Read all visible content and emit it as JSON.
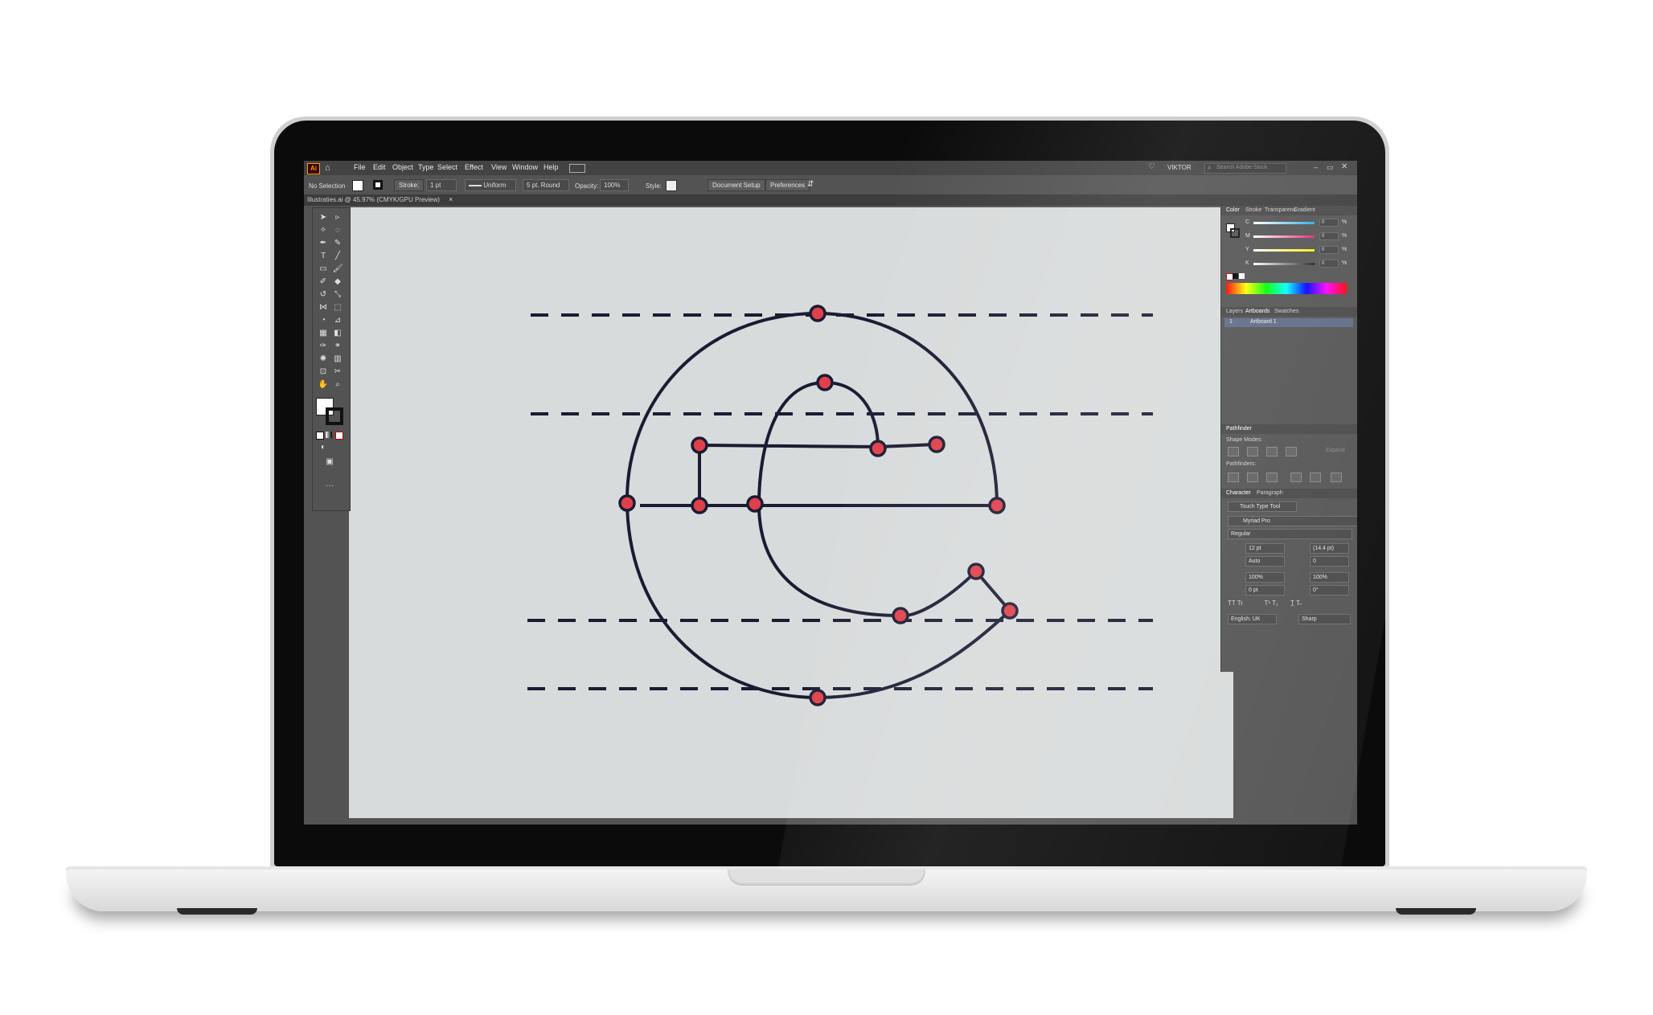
{
  "app": {
    "logo": "Ai",
    "title_tab": "Illustraties.ai @ 45.97% (CMYK/GPU Preview)",
    "close_tab": "×"
  },
  "menu": [
    "File",
    "Edit",
    "Object",
    "Type",
    "Select",
    "Effect",
    "View",
    "Window",
    "Help"
  ],
  "topright": {
    "user": "VIKTOR",
    "search_placeholder": "Search Adobe Stock"
  },
  "control": {
    "selection": "No Selection",
    "stroke_label": "Stroke:",
    "stroke_weight": "1 pt",
    "profile": "Uniform",
    "brush": "5 pt. Round",
    "opacity_label": "Opacity:",
    "opacity": "100%",
    "style_label": "Style:",
    "document_setup": "Document Setup",
    "preferences": "Preferences"
  },
  "panels": {
    "color_tabs": [
      "Color",
      "Stroke",
      "Transparenc",
      "Gradient"
    ],
    "color_channels": [
      {
        "label": "C",
        "value": "0",
        "unit": "%",
        "color": "#29abe2"
      },
      {
        "label": "M",
        "value": "0",
        "unit": "%",
        "color": "#ec1e79"
      },
      {
        "label": "Y",
        "value": "0",
        "unit": "%",
        "color": "#ffee00"
      },
      {
        "label": "K",
        "value": "0",
        "unit": "%",
        "color": "#222222"
      }
    ],
    "artboard_tabs": [
      "Layers",
      "Artboards",
      "Swatches"
    ],
    "artboard_row": {
      "index": "1",
      "name": "Artboard 1"
    },
    "pathfinder_title": "Pathfinder",
    "shape_modes_label": "Shape Modes:",
    "expand_label": "Expand",
    "pathfinders_label": "Pathfinders:",
    "char_tabs": [
      "Character",
      "Paragraph"
    ],
    "touch_type": "Touch Type Tool",
    "font_family": "Myriad Pro",
    "font_style": "Regular",
    "font_size": "12 pt",
    "leading": "(14.4 pt)",
    "kerning": "Auto",
    "tracking": "0",
    "vscale": "100%",
    "hscale": "100%",
    "baseline": "0 pt",
    "rotation": "0°",
    "language": "English: UK",
    "aa": "Sharp"
  },
  "colors": {
    "glyph_stroke": "#1b1b33",
    "anchor_fill": "#e0404a",
    "canvas": "#d8dbdb"
  }
}
